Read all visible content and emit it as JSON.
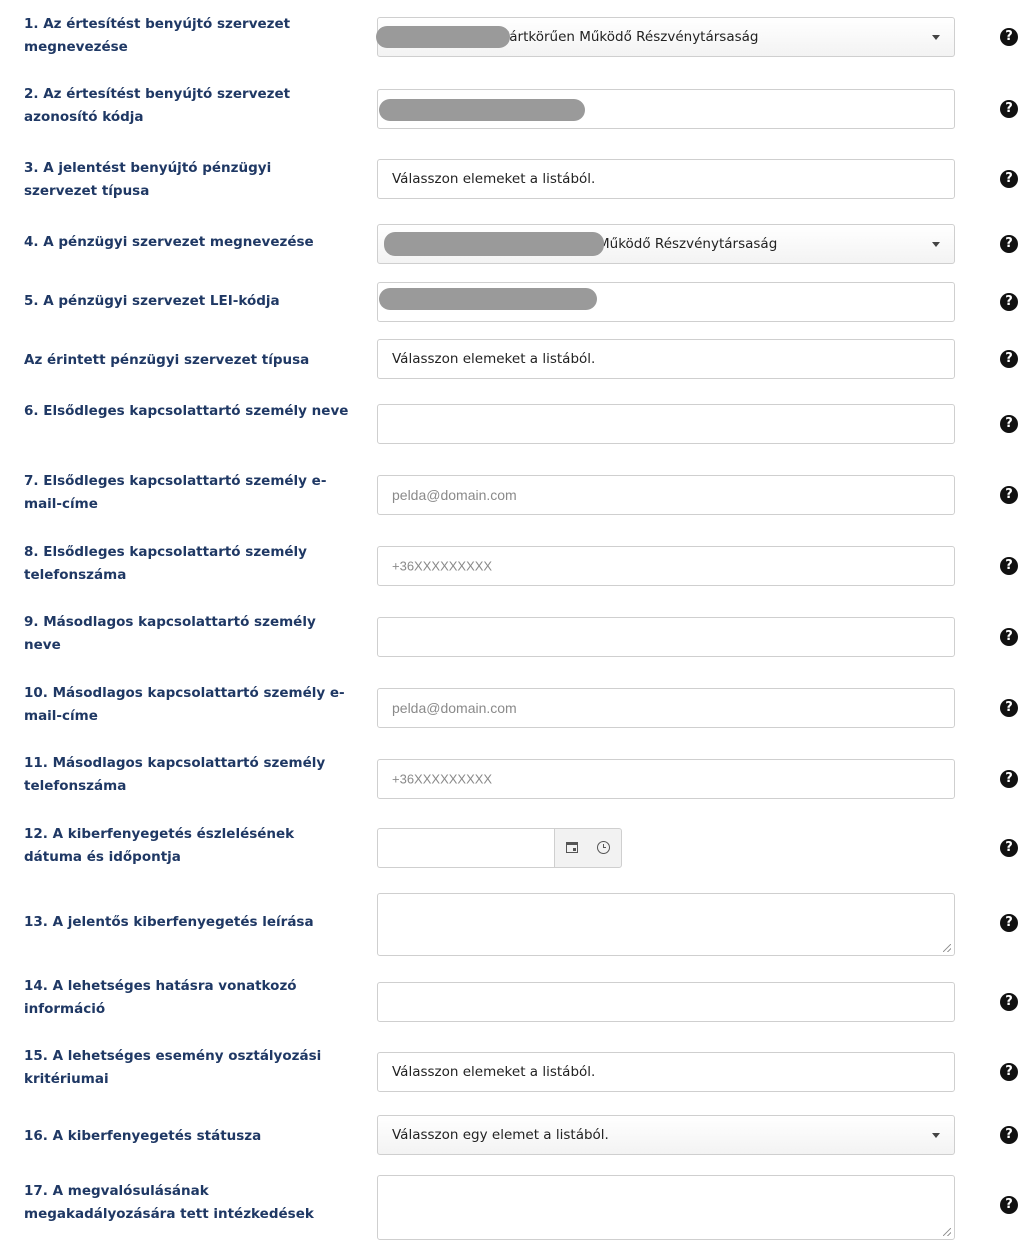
{
  "help_icon": "?",
  "fields": [
    {
      "label": "1. Az értesítést benyújtó szervezet megnevezése",
      "type": "select",
      "value": "Zártkörűen Működő Részvénytársaság"
    },
    {
      "label": "2. Az értesítést benyújtó szervezet azonosító kódja",
      "type": "text",
      "value": ""
    },
    {
      "label": "3. A jelentést benyújtó pénzügyi szervezet típusa",
      "type": "multiselect",
      "value": "Válasszon elemeket a listából."
    },
    {
      "label": "4. A pénzügyi szervezet megnevezése",
      "type": "select",
      "value": "Működő Részvénytársaság"
    },
    {
      "label": "5. A pénzügyi szervezet LEI-kódja",
      "type": "text",
      "value": ""
    },
    {
      "label": "Az érintett pénzügyi szervezet típusa",
      "type": "multiselect",
      "value": "Válasszon elemeket a listából."
    },
    {
      "label": "6. Elsődleges kapcsolattartó személy neve",
      "type": "text",
      "value": ""
    },
    {
      "label": "7. Elsődleges kapcsolattartó személy e-mail-címe",
      "type": "email",
      "placeholder": "pelda@domain.com"
    },
    {
      "label": "8. Elsődleges kapcsolattartó személy telefonszáma",
      "type": "tel",
      "placeholder": "+36XXXXXXXXX"
    },
    {
      "label": "9. Másodlagos kapcsolattartó személy neve",
      "type": "text",
      "value": ""
    },
    {
      "label": "10. Másodlagos kapcsolattartó személy e-mail-címe",
      "type": "email",
      "placeholder": "pelda@domain.com"
    },
    {
      "label": "11. Másodlagos kapcsolattartó személy telefonszáma",
      "type": "tel",
      "placeholder": "+36XXXXXXXXX"
    },
    {
      "label": "12. A kiberfenyegetés észlelésének dátuma és időpontja",
      "type": "datetime",
      "value": ""
    },
    {
      "label": "13. A jelentős kiberfenyegetés leírása",
      "type": "textarea",
      "value": ""
    },
    {
      "label": "14. A lehetséges hatásra vonatkozó információ",
      "type": "text",
      "value": ""
    },
    {
      "label": "15. A lehetséges esemény osztályozási kritériumai",
      "type": "multiselect",
      "value": "Válasszon elemeket a listából."
    },
    {
      "label": "16. A kiberfenyegetés státusza",
      "type": "select",
      "value": "Válasszon egy elemet a listából."
    },
    {
      "label": "17. A megvalósulásának megakadályozására tett intézkedések",
      "type": "textarea",
      "value": ""
    }
  ]
}
